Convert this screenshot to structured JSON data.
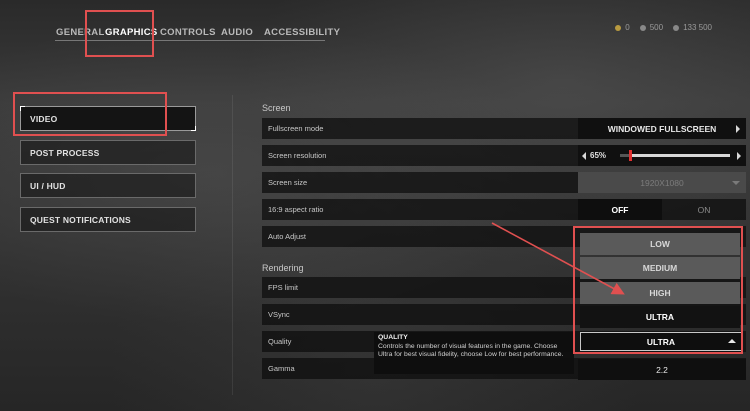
{
  "top_tabs": [
    {
      "label": "GENERAL",
      "active": false
    },
    {
      "label": "GRAPHICS",
      "active": true
    },
    {
      "label": "CONTROLS",
      "active": false
    },
    {
      "label": "AUDIO",
      "active": false
    },
    {
      "label": "ACCESSIBILITY",
      "active": false
    }
  ],
  "stats": {
    "a": "0",
    "b": "500",
    "c": "133 500"
  },
  "sidebar": {
    "items": [
      {
        "label": "VIDEO",
        "active": true
      },
      {
        "label": "POST PROCESS",
        "active": false
      },
      {
        "label": "UI / HUD",
        "active": false
      },
      {
        "label": "QUEST NOTIFICATIONS",
        "active": false
      }
    ]
  },
  "screen": {
    "title": "Screen",
    "fullscreen_mode": {
      "label": "Fullscreen mode",
      "value": "WINDOWED FULLSCREEN"
    },
    "screen_resolution": {
      "label": "Screen resolution",
      "value": "65%",
      "level": 0.65
    },
    "screen_size": {
      "label": "Screen size",
      "value": "1920X1080"
    },
    "aspect_ratio": {
      "label": "16:9 aspect ratio",
      "off": "OFF",
      "on": "ON",
      "selected": "OFF"
    },
    "auto_adjust": {
      "label": "Auto Adjust"
    }
  },
  "rendering": {
    "title": "Rendering",
    "fps_limit": {
      "label": "FPS limit"
    },
    "vsync": {
      "label": "VSync"
    },
    "quality": {
      "label": "Quality",
      "value": "ULTRA"
    },
    "gamma": {
      "label": "Gamma",
      "value": "2.2"
    }
  },
  "quality_dropdown": {
    "options": [
      "LOW",
      "MEDIUM",
      "HIGH",
      "ULTRA"
    ],
    "selected": "ULTRA"
  },
  "tooltip": {
    "title": "QUALITY",
    "body": "Controls the number of visual features in the game. Choose Ultra for best visual fidelity, choose Low for best performance."
  },
  "colors": {
    "highlight": "#e05050",
    "slider_thumb": "#e03030"
  }
}
